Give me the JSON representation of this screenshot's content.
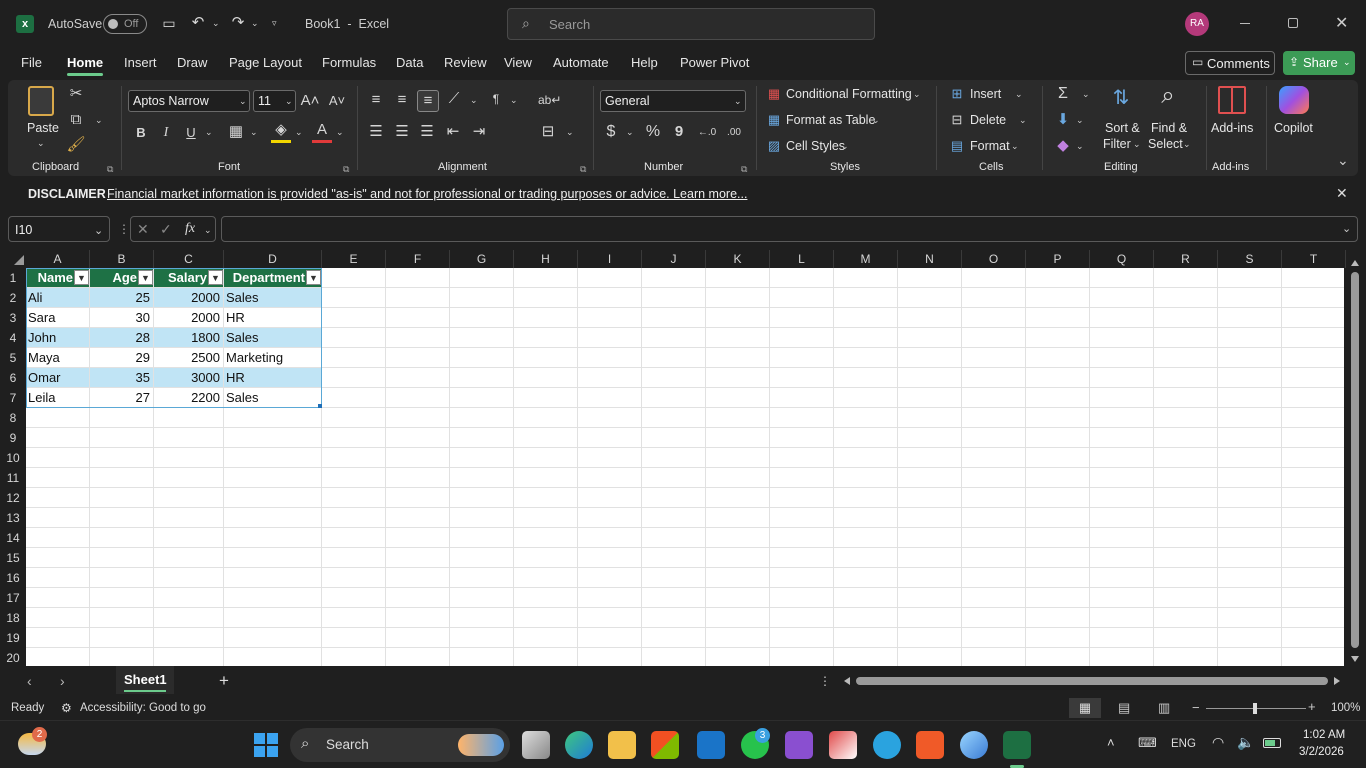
{
  "titlebar": {
    "autosave_label": "AutoSave",
    "autosave_state": "Off",
    "doc_title": "Book1  -  Excel",
    "search_placeholder": "Search",
    "avatar_initials": "RA"
  },
  "tabs": [
    "File",
    "Home",
    "Insert",
    "Draw",
    "Page Layout",
    "Formulas",
    "Data",
    "Review",
    "View",
    "Automate",
    "Help",
    "Power Pivot"
  ],
  "active_tab": "Home",
  "comments_label": "Comments",
  "share_label": "Share",
  "ribbon": {
    "clipboard": {
      "paste": "Paste",
      "group": "Clipboard"
    },
    "font": {
      "name": "Aptos Narrow",
      "size": "11",
      "group": "Font",
      "bold": "B",
      "italic": "I",
      "underline": "U"
    },
    "alignment": {
      "group": "Alignment"
    },
    "number": {
      "format": "General",
      "group": "Number",
      "currency": "$",
      "percent": "%",
      "comma": "9"
    },
    "styles": {
      "conditional": "Conditional Formatting",
      "format_table": "Format as Table",
      "cell_styles": "Cell Styles",
      "group": "Styles"
    },
    "cells": {
      "insert": "Insert",
      "delete": "Delete",
      "format": "Format",
      "group": "Cells"
    },
    "editing": {
      "sort": "Sort &",
      "sort2": "Filter",
      "find": "Find &",
      "find2": "Select",
      "group": "Editing"
    },
    "addins": {
      "label": "Add-ins",
      "group": "Add-ins"
    },
    "copilot": {
      "label": "Copilot"
    }
  },
  "disclaimer": {
    "title": "DISCLAIMER",
    "text": "Financial market information is provided \"as-is\" and not for professional or trading purposes or advice. Learn more..."
  },
  "formula": {
    "name_box": "I10",
    "fx": "fx",
    "value": ""
  },
  "columns": [
    "A",
    "B",
    "C",
    "D",
    "E",
    "F",
    "G",
    "H",
    "I",
    "J",
    "K",
    "L",
    "M",
    "N",
    "O",
    "P",
    "Q",
    "R",
    "S",
    "T"
  ],
  "rows": [
    "1",
    "2",
    "3",
    "4",
    "5",
    "6",
    "7",
    "8",
    "9",
    "10",
    "11",
    "12",
    "13",
    "14",
    "15",
    "16",
    "17",
    "18",
    "19",
    "20"
  ],
  "table": {
    "headers": [
      "Name",
      "Age",
      "Salary",
      "Department"
    ],
    "rows": [
      [
        "Ali",
        "25",
        "2000",
        "Sales"
      ],
      [
        "Sara",
        "30",
        "2000",
        "HR"
      ],
      [
        "John",
        "28",
        "1800",
        "Sales"
      ],
      [
        "Maya",
        "29",
        "2500",
        "Marketing"
      ],
      [
        "Omar",
        "35",
        "3000",
        "HR"
      ],
      [
        "Leila",
        "27",
        "2200",
        "Sales"
      ]
    ]
  },
  "sheet": {
    "name": "Sheet1",
    "add": "+"
  },
  "status": {
    "ready": "Ready",
    "accessibility": "Accessibility: Good to go",
    "zoom": "100%"
  },
  "taskbar": {
    "search": "Search",
    "weather_badge": "2",
    "whatsapp_badge": "3",
    "lang": "ENG",
    "time": "1:02 AM",
    "date": "3/2/2026"
  },
  "colors": {
    "accent": "#6ccb8c",
    "table_header": "#1e7145",
    "band": "#c0e4f5",
    "share": "#3c9b56"
  }
}
